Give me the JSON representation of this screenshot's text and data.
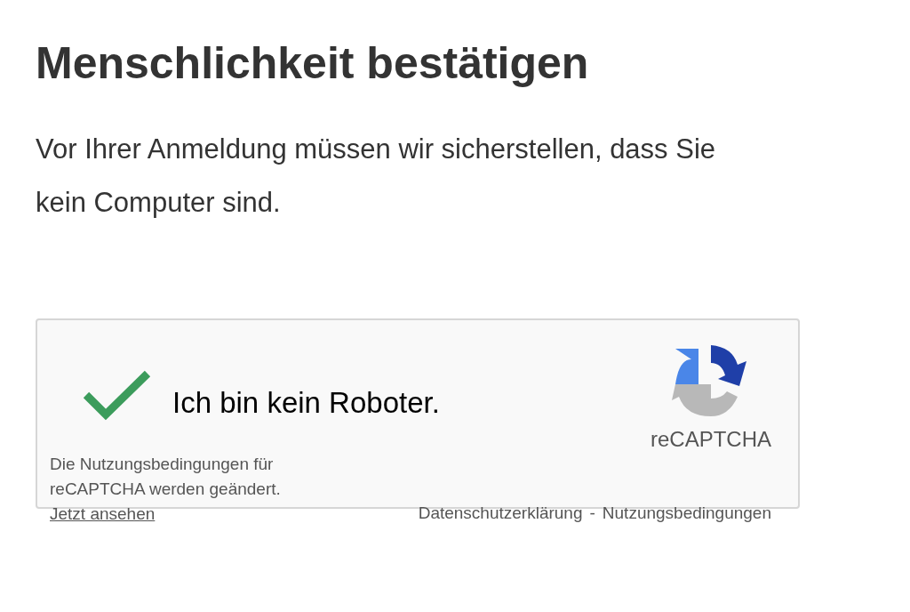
{
  "title": "Menschlichkeit bestätigen",
  "intro": "Vor Ihrer Anmeldung müssen wir sicherstellen, dass Sie kein Computer sind.",
  "captcha": {
    "checked": true,
    "label": "Ich bin kein Roboter.",
    "brand": "reCAPTCHA",
    "notice": "Die Nutzungsbedingungen für reCAPTCHA werden geändert.",
    "notice_link": "Jetzt ansehen",
    "footer_links": [
      "Datenschutzerklärung",
      "Nutzungsbedingungen"
    ],
    "separator": "-"
  }
}
